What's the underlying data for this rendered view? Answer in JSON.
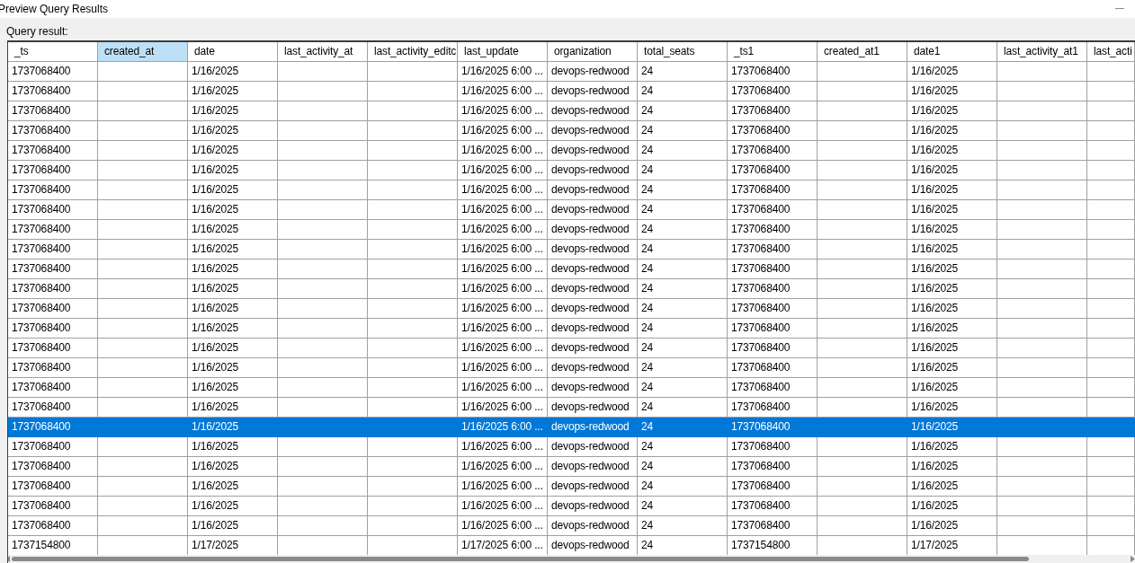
{
  "window": {
    "title": "Preview Query Results"
  },
  "label": "Query result:",
  "table": {
    "columns": [
      {
        "label": "_ts",
        "selected": false
      },
      {
        "label": "created_at",
        "selected": true
      },
      {
        "label": "date",
        "selected": false
      },
      {
        "label": "last_activity_at",
        "selected": false
      },
      {
        "label": "last_activity_editc",
        "selected": false
      },
      {
        "label": "last_update",
        "selected": false
      },
      {
        "label": "organization",
        "selected": false
      },
      {
        "label": "total_seats",
        "selected": false
      },
      {
        "label": "_ts1",
        "selected": false
      },
      {
        "label": "created_at1",
        "selected": false
      },
      {
        "label": "date1",
        "selected": false
      },
      {
        "label": "last_activity_at1",
        "selected": false
      },
      {
        "label": "last_acti",
        "selected": false
      }
    ],
    "rows": [
      {
        "selected": false,
        "cells": [
          "1737068400",
          null,
          "1/16/2025",
          null,
          null,
          "1/16/2025 6:00 ...",
          "devops-redwood",
          "24",
          "1737068400",
          null,
          "1/16/2025",
          null,
          null
        ]
      },
      {
        "selected": false,
        "cells": [
          "1737068400",
          null,
          "1/16/2025",
          null,
          null,
          "1/16/2025 6:00 ...",
          "devops-redwood",
          "24",
          "1737068400",
          null,
          "1/16/2025",
          null,
          null
        ]
      },
      {
        "selected": false,
        "cells": [
          "1737068400",
          null,
          "1/16/2025",
          null,
          null,
          "1/16/2025 6:00 ...",
          "devops-redwood",
          "24",
          "1737068400",
          null,
          "1/16/2025",
          null,
          null
        ]
      },
      {
        "selected": false,
        "cells": [
          "1737068400",
          null,
          "1/16/2025",
          null,
          null,
          "1/16/2025 6:00 ...",
          "devops-redwood",
          "24",
          "1737068400",
          null,
          "1/16/2025",
          null,
          null
        ]
      },
      {
        "selected": false,
        "cells": [
          "1737068400",
          null,
          "1/16/2025",
          null,
          null,
          "1/16/2025 6:00 ...",
          "devops-redwood",
          "24",
          "1737068400",
          null,
          "1/16/2025",
          null,
          null
        ]
      },
      {
        "selected": false,
        "cells": [
          "1737068400",
          null,
          "1/16/2025",
          null,
          null,
          "1/16/2025 6:00 ...",
          "devops-redwood",
          "24",
          "1737068400",
          null,
          "1/16/2025",
          null,
          null
        ]
      },
      {
        "selected": false,
        "cells": [
          "1737068400",
          null,
          "1/16/2025",
          null,
          null,
          "1/16/2025 6:00 ...",
          "devops-redwood",
          "24",
          "1737068400",
          null,
          "1/16/2025",
          null,
          null
        ]
      },
      {
        "selected": false,
        "cells": [
          "1737068400",
          null,
          "1/16/2025",
          null,
          null,
          "1/16/2025 6:00 ...",
          "devops-redwood",
          "24",
          "1737068400",
          null,
          "1/16/2025",
          null,
          null
        ]
      },
      {
        "selected": false,
        "cells": [
          "1737068400",
          null,
          "1/16/2025",
          null,
          null,
          "1/16/2025 6:00 ...",
          "devops-redwood",
          "24",
          "1737068400",
          null,
          "1/16/2025",
          null,
          null
        ]
      },
      {
        "selected": false,
        "cells": [
          "1737068400",
          null,
          "1/16/2025",
          null,
          null,
          "1/16/2025 6:00 ...",
          "devops-redwood",
          "24",
          "1737068400",
          null,
          "1/16/2025",
          null,
          null
        ]
      },
      {
        "selected": false,
        "cells": [
          "1737068400",
          null,
          "1/16/2025",
          null,
          null,
          "1/16/2025 6:00 ...",
          "devops-redwood",
          "24",
          "1737068400",
          null,
          "1/16/2025",
          null,
          null
        ]
      },
      {
        "selected": false,
        "cells": [
          "1737068400",
          null,
          "1/16/2025",
          null,
          null,
          "1/16/2025 6:00 ...",
          "devops-redwood",
          "24",
          "1737068400",
          null,
          "1/16/2025",
          null,
          null
        ]
      },
      {
        "selected": false,
        "cells": [
          "1737068400",
          null,
          "1/16/2025",
          null,
          null,
          "1/16/2025 6:00 ...",
          "devops-redwood",
          "24",
          "1737068400",
          null,
          "1/16/2025",
          null,
          null
        ]
      },
      {
        "selected": false,
        "cells": [
          "1737068400",
          null,
          "1/16/2025",
          null,
          null,
          "1/16/2025 6:00 ...",
          "devops-redwood",
          "24",
          "1737068400",
          null,
          "1/16/2025",
          null,
          null
        ]
      },
      {
        "selected": false,
        "cells": [
          "1737068400",
          null,
          "1/16/2025",
          null,
          null,
          "1/16/2025 6:00 ...",
          "devops-redwood",
          "24",
          "1737068400",
          null,
          "1/16/2025",
          null,
          null
        ]
      },
      {
        "selected": false,
        "cells": [
          "1737068400",
          null,
          "1/16/2025",
          null,
          null,
          "1/16/2025 6:00 ...",
          "devops-redwood",
          "24",
          "1737068400",
          null,
          "1/16/2025",
          null,
          null
        ]
      },
      {
        "selected": false,
        "cells": [
          "1737068400",
          null,
          "1/16/2025",
          null,
          null,
          "1/16/2025 6:00 ...",
          "devops-redwood",
          "24",
          "1737068400",
          null,
          "1/16/2025",
          null,
          null
        ]
      },
      {
        "selected": false,
        "cells": [
          "1737068400",
          null,
          "1/16/2025",
          null,
          null,
          "1/16/2025 6:00 ...",
          "devops-redwood",
          "24",
          "1737068400",
          null,
          "1/16/2025",
          null,
          null
        ]
      },
      {
        "selected": true,
        "cells": [
          "1737068400",
          null,
          "1/16/2025",
          null,
          null,
          "1/16/2025 6:00 ...",
          "devops-redwood",
          "24",
          "1737068400",
          null,
          "1/16/2025",
          null,
          null
        ]
      },
      {
        "selected": false,
        "cells": [
          "1737068400",
          null,
          "1/16/2025",
          null,
          null,
          "1/16/2025 6:00 ...",
          "devops-redwood",
          "24",
          "1737068400",
          null,
          "1/16/2025",
          null,
          null
        ]
      },
      {
        "selected": false,
        "cells": [
          "1737068400",
          null,
          "1/16/2025",
          null,
          null,
          "1/16/2025 6:00 ...",
          "devops-redwood",
          "24",
          "1737068400",
          null,
          "1/16/2025",
          null,
          null
        ]
      },
      {
        "selected": false,
        "cells": [
          "1737068400",
          null,
          "1/16/2025",
          null,
          null,
          "1/16/2025 6:00 ...",
          "devops-redwood",
          "24",
          "1737068400",
          null,
          "1/16/2025",
          null,
          null
        ]
      },
      {
        "selected": false,
        "cells": [
          "1737068400",
          null,
          "1/16/2025",
          null,
          null,
          "1/16/2025 6:00 ...",
          "devops-redwood",
          "24",
          "1737068400",
          null,
          "1/16/2025",
          null,
          null
        ]
      },
      {
        "selected": false,
        "cells": [
          "1737068400",
          null,
          "1/16/2025",
          null,
          null,
          "1/16/2025 6:00 ...",
          "devops-redwood",
          "24",
          "1737068400",
          null,
          "1/16/2025",
          null,
          null
        ]
      },
      {
        "selected": false,
        "cells": [
          "1737154800",
          null,
          "1/17/2025",
          null,
          null,
          "1/17/2025 6:00 ...",
          "devops-redwood",
          "24",
          "1737154800",
          null,
          "1/17/2025",
          null,
          null
        ]
      }
    ]
  }
}
